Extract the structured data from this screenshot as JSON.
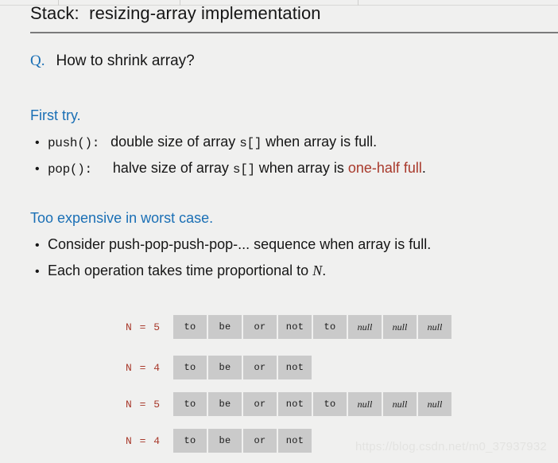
{
  "chrome": {
    "divider_positions": [
      73,
      226,
      450,
      760,
      1070
    ]
  },
  "slide": {
    "title": "Stack:  resizing-array implementation",
    "question_marker": "Q.",
    "question_text": "How to shrink array?",
    "first_try": {
      "heading": "First try.",
      "bullets": [
        {
          "code": "push():",
          "text_before": "double size of array ",
          "code_inline": "s[]",
          "text_after": " when array is full.",
          "highlight": "",
          "tail": ""
        },
        {
          "code": "pop():",
          "text_before": "halve size of array ",
          "code_inline": "s[]",
          "text_after": " when array is ",
          "highlight": "one-half full",
          "tail": "."
        }
      ]
    },
    "too_expensive": {
      "heading": "Too expensive in worst case.",
      "bullets": [
        {
          "text_before": "Consider push-pop-push-pop-... sequence when array is full.",
          "math": "",
          "tail": ""
        },
        {
          "text_before": "Each operation takes time proportional to ",
          "math": "N",
          "tail": "."
        }
      ]
    },
    "bullet_glyph": "•"
  },
  "diagram": {
    "rows": [
      {
        "n_label": "N = 5",
        "cells": [
          {
            "value": "to",
            "is_null": false
          },
          {
            "value": "be",
            "is_null": false
          },
          {
            "value": "or",
            "is_null": false
          },
          {
            "value": "not",
            "is_null": false
          },
          {
            "value": "to",
            "is_null": false
          },
          {
            "value": "null",
            "is_null": true
          },
          {
            "value": "null",
            "is_null": true
          },
          {
            "value": "null",
            "is_null": true
          }
        ]
      },
      {
        "n_label": "N = 4",
        "cells": [
          {
            "value": "to",
            "is_null": false
          },
          {
            "value": "be",
            "is_null": false
          },
          {
            "value": "or",
            "is_null": false
          },
          {
            "value": "not",
            "is_null": false
          }
        ]
      },
      {
        "n_label": "N = 5",
        "cells": [
          {
            "value": "to",
            "is_null": false
          },
          {
            "value": "be",
            "is_null": false
          },
          {
            "value": "or",
            "is_null": false
          },
          {
            "value": "not",
            "is_null": false
          },
          {
            "value": "to",
            "is_null": false
          },
          {
            "value": "null",
            "is_null": true
          },
          {
            "value": "null",
            "is_null": true
          },
          {
            "value": "null",
            "is_null": true
          }
        ]
      },
      {
        "n_label": "N = 4",
        "cells": [
          {
            "value": "to",
            "is_null": false
          },
          {
            "value": "be",
            "is_null": false
          },
          {
            "value": "or",
            "is_null": false
          },
          {
            "value": "not",
            "is_null": false
          }
        ]
      }
    ],
    "row_tops": [
      396,
      447,
      493,
      539
    ]
  },
  "watermark": {
    "text": "https://blog.csdn.net/m0_37937932"
  },
  "colors": {
    "background": "#f0f0ef",
    "text": "#161616",
    "accent_blue": "#1a6fb5",
    "accent_red": "#a8392b",
    "cell_fill": "#cacaca",
    "rule": "#7b7b7b",
    "watermark": "#e3e3e1"
  }
}
